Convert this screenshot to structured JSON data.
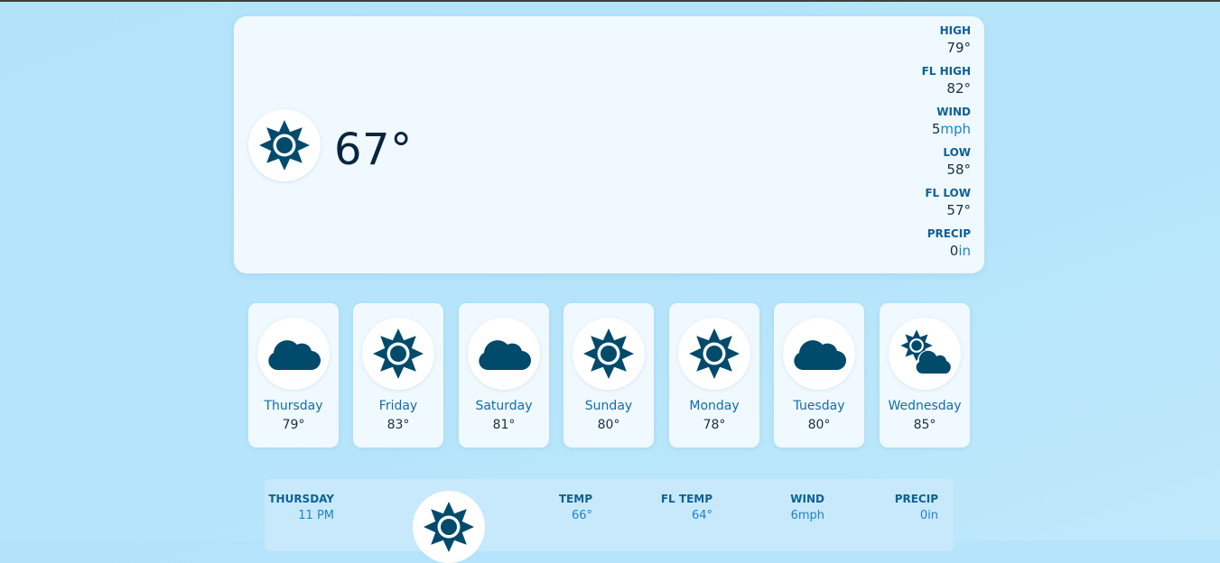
{
  "current": {
    "icon": "sun-icon",
    "temperature": "67°",
    "stats": [
      {
        "label": "HIGH",
        "value": "79°",
        "unit": ""
      },
      {
        "label": "FL HIGH",
        "value": "82°",
        "unit": ""
      },
      {
        "label": "WIND",
        "value": "5",
        "unit": "mph"
      },
      {
        "label": "LOW",
        "value": "58°",
        "unit": ""
      },
      {
        "label": "FL LOW",
        "value": "57°",
        "unit": ""
      },
      {
        "label": "PRECIP",
        "value": "0",
        "unit": "in"
      }
    ]
  },
  "forecast": [
    {
      "day": "Thursday",
      "temp": "79°",
      "icon": "cloud-icon"
    },
    {
      "day": "Friday",
      "temp": "83°",
      "icon": "sun-icon"
    },
    {
      "day": "Saturday",
      "temp": "81°",
      "icon": "cloud-icon"
    },
    {
      "day": "Sunday",
      "temp": "80°",
      "icon": "sun-icon"
    },
    {
      "day": "Monday",
      "temp": "78°",
      "icon": "sun-icon"
    },
    {
      "day": "Tuesday",
      "temp": "80°",
      "icon": "cloud-icon"
    },
    {
      "day": "Wednesday",
      "temp": "85°",
      "icon": "partly-cloudy-icon"
    }
  ],
  "hourly": [
    {
      "day": "THURSDAY",
      "time": "11 PM",
      "icon": "sun-icon",
      "temp_label": "TEMP",
      "temp": "66°",
      "fl_temp_label": "FL TEMP",
      "fl_temp": "64°",
      "wind_label": "WIND",
      "wind": "6",
      "wind_unit": "mph",
      "precip_label": "PRECIP",
      "precip": "0",
      "precip_unit": "in"
    }
  ],
  "colors": {
    "background": "#b3e3fb",
    "card": "#f0f9ff",
    "icon": "#004a6c",
    "label": "#0e6194",
    "accent": "#1f83c4",
    "text": "#1a2f40"
  }
}
